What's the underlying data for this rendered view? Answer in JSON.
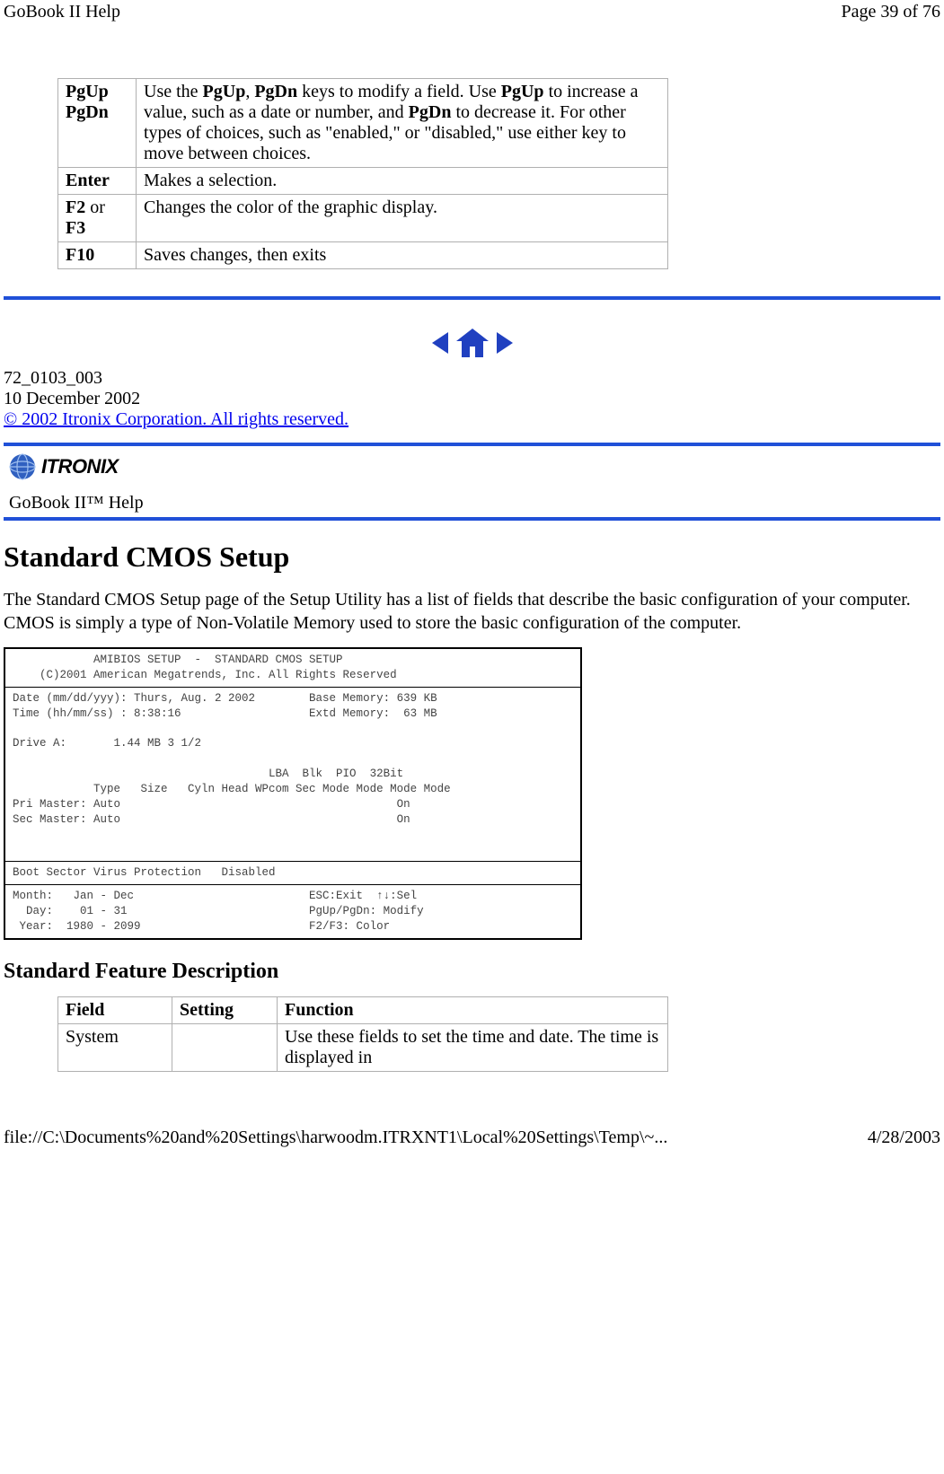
{
  "header": {
    "left": "GoBook II Help",
    "right": "Page 39 of 76"
  },
  "key_table": {
    "rows": [
      {
        "key_html": "<span class=\"bold\">PgUp<br>PgDn</span>",
        "desc_html": "Use the <span class=\"bold\">PgUp</span>, <span class=\"bold\">PgDn</span> keys to modify a field.  Use <span class=\"bold\">PgUp</span> to increase a value, such as a date or number, and <span class=\"bold\">PgDn</span> to decrease it.  For other types of choices, such as \"enabled,\" or \"disabled,\" use either key to move between choices."
      },
      {
        "key_html": "<span class=\"bold\">Enter</span>",
        "desc_html": "Makes a selection."
      },
      {
        "key_html": "<span class=\"bold\">F2</span> or <span class=\"bold\">F3</span>",
        "desc_html": "Changes the color of the graphic display."
      },
      {
        "key_html": "<span class=\"bold\">F10</span>",
        "desc_html": "Saves changes, then exits"
      }
    ]
  },
  "doc_info": {
    "code": "72_0103_003",
    "date": "10 December 2002",
    "copyright": "© 2002 Itronix Corporation.  All rights reserved."
  },
  "logo": {
    "brand": "ITRONIX",
    "subtitle": "GoBook II™ Help"
  },
  "section": {
    "heading": "Standard CMOS Setup",
    "intro": "The Standard CMOS Setup page of the Setup Utility has a list of fields that describe the basic configuration of your computer.  CMOS is simply a type of Non-Volatile Memory used to store the basic configuration of the computer."
  },
  "bios": {
    "title1": "            AMIBIOS SETUP  -  STANDARD CMOS SETUP",
    "title2": "    (C)2001 American Megatrends, Inc. All Rights Reserved",
    "body1": "Date (mm/dd/yyy): Thurs, Aug. 2 2002        Base Memory: 639 KB\nTime (hh/mm/ss) : 8:38:16                   Extd Memory:  63 MB\n\nDrive A:       1.44 MB 3 1/2\n\n                                      LBA  Blk  PIO  32Bit\n            Type   Size   Cyln Head WPcom Sec Mode Mode Mode Mode\nPri Master: Auto                                         On\nSec Master: Auto                                         On\n\n\n",
    "body2": "Boot Sector Virus Protection   Disabled",
    "body3": "Month:   Jan - Dec                          ESC:Exit  ↑↓:Sel\n  Day:    01 - 31                           PgUp/PgDn: Modify\n Year:  1980 - 2099                         F2/F3: Color"
  },
  "desc_heading": "Standard Feature Description",
  "desc_table": {
    "headers": [
      "Field",
      "Setting",
      "Function"
    ],
    "rows": [
      {
        "field": "System",
        "setting": "",
        "function": "Use these fields to set the time and date.  The time is displayed in"
      }
    ]
  },
  "footer": {
    "left": "file://C:\\Documents%20and%20Settings\\harwoodm.ITRXNT1\\Local%20Settings\\Temp\\~...",
    "right": "4/28/2003"
  }
}
